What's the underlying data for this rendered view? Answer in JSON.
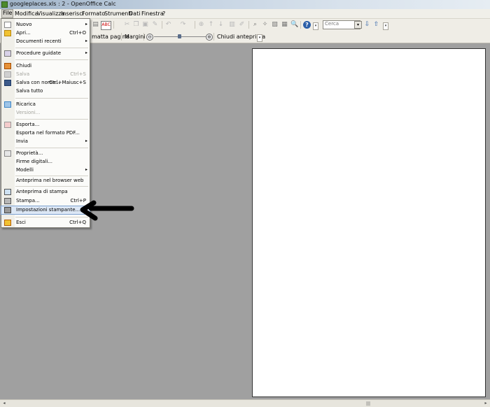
{
  "window": {
    "title": "googleplaces.xls : 2 - OpenOffice Calc"
  },
  "menubar": {
    "items": [
      "File",
      "Modifica",
      "Visualizza",
      "Inserisci",
      "Formato",
      "Strumenti",
      "Dati",
      "Finestra",
      "?"
    ]
  },
  "toolbar": {
    "search_placeholder": "Cerca"
  },
  "preview_toolbar": {
    "page_format_label": "matta pagina",
    "margins_label": "Margini",
    "zoom_minus": "⊖",
    "zoom_plus": "⊕",
    "close_preview_label": "Chiudi anteprima"
  },
  "file_menu": {
    "items": [
      {
        "label": "Nuovo",
        "shortcut": "",
        "submenu": true,
        "disabled": false
      },
      {
        "label": "Apri...",
        "shortcut": "Ctrl+O",
        "submenu": false,
        "disabled": false
      },
      {
        "label": "Documenti recenti",
        "shortcut": "",
        "submenu": true,
        "disabled": false
      },
      {
        "label": "Procedure guidate",
        "shortcut": "",
        "submenu": true,
        "disabled": false
      },
      {
        "label": "Chiudi",
        "shortcut": "",
        "submenu": false,
        "disabled": false
      },
      {
        "label": "Salva",
        "shortcut": "Ctrl+S",
        "submenu": false,
        "disabled": true
      },
      {
        "label": "Salva con nome...",
        "shortcut": "Ctrl+Maiusc+S",
        "submenu": false,
        "disabled": false
      },
      {
        "label": "Salva tutto",
        "shortcut": "",
        "submenu": false,
        "disabled": false
      },
      {
        "label": "Ricarica",
        "shortcut": "",
        "submenu": false,
        "disabled": false
      },
      {
        "label": "Versioni...",
        "shortcut": "",
        "submenu": false,
        "disabled": true
      },
      {
        "label": "Esporta...",
        "shortcut": "",
        "submenu": false,
        "disabled": false
      },
      {
        "label": "Esporta nel formato PDF...",
        "shortcut": "",
        "submenu": false,
        "disabled": false
      },
      {
        "label": "Invia",
        "shortcut": "",
        "submenu": true,
        "disabled": false
      },
      {
        "label": "Proprietà...",
        "shortcut": "",
        "submenu": false,
        "disabled": false
      },
      {
        "label": "Firme digitali...",
        "shortcut": "",
        "submenu": false,
        "disabled": false
      },
      {
        "label": "Modelli",
        "shortcut": "",
        "submenu": true,
        "disabled": false
      },
      {
        "label": "Anteprima nel browser web",
        "shortcut": "",
        "submenu": false,
        "disabled": false
      },
      {
        "label": "Anteprima di stampa",
        "shortcut": "",
        "submenu": false,
        "disabled": false
      },
      {
        "label": "Stampa...",
        "shortcut": "Ctrl+P",
        "submenu": false,
        "disabled": false
      },
      {
        "label": "Impostazioni stampante...",
        "shortcut": "",
        "submenu": false,
        "disabled": false
      },
      {
        "label": "Esci",
        "shortcut": "Ctrl+Q",
        "submenu": false,
        "disabled": false
      }
    ]
  },
  "colors": {
    "workspace": "#a0a0a0",
    "menu_highlight": "#dce7f5",
    "help_icon": "#2c5fa8"
  },
  "icons": {
    "pointer_arrow": "black-arrow-pointing-left"
  }
}
